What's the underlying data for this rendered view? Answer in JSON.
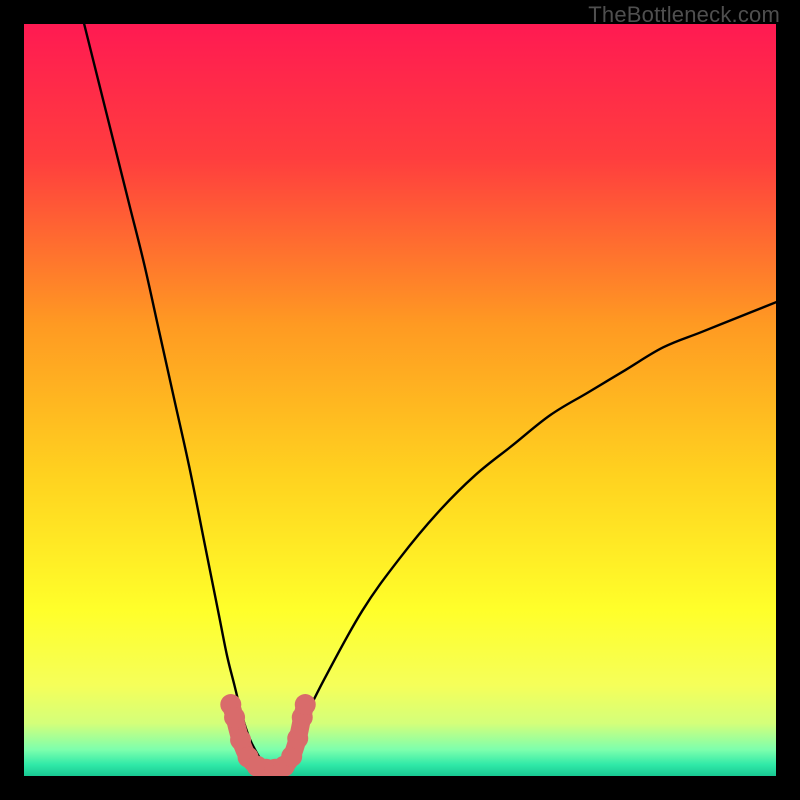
{
  "watermark": "TheBottleneck.com",
  "chart_data": {
    "type": "line",
    "title": "",
    "xlabel": "",
    "ylabel": "",
    "xlim": [
      0,
      100
    ],
    "ylim": [
      0,
      100
    ],
    "gradient_stops": [
      {
        "pos": 0.0,
        "color": "#ff1a52"
      },
      {
        "pos": 0.18,
        "color": "#ff3e3e"
      },
      {
        "pos": 0.4,
        "color": "#ff9a22"
      },
      {
        "pos": 0.6,
        "color": "#ffd21f"
      },
      {
        "pos": 0.78,
        "color": "#ffff2a"
      },
      {
        "pos": 0.88,
        "color": "#f5ff5a"
      },
      {
        "pos": 0.93,
        "color": "#d4ff7a"
      },
      {
        "pos": 0.965,
        "color": "#7dffad"
      },
      {
        "pos": 0.985,
        "color": "#30e9a8"
      },
      {
        "pos": 1.0,
        "color": "#18c792"
      }
    ],
    "series": [
      {
        "name": "left-curve",
        "x": [
          8,
          10,
          12,
          14,
          16,
          18,
          20,
          22,
          24,
          25,
          26,
          27,
          28,
          29,
          30,
          31,
          32,
          33
        ],
        "y": [
          100,
          92,
          84,
          76,
          68,
          59,
          50,
          41,
          31,
          26,
          21,
          16,
          12,
          8,
          5,
          3,
          1.5,
          0.8
        ]
      },
      {
        "name": "right-curve",
        "x": [
          33,
          34,
          35,
          37,
          40,
          45,
          50,
          55,
          60,
          65,
          70,
          75,
          80,
          85,
          90,
          95,
          100
        ],
        "y": [
          0.8,
          1.5,
          3,
          7,
          13,
          22,
          29,
          35,
          40,
          44,
          48,
          51,
          54,
          57,
          59,
          61,
          63
        ]
      }
    ],
    "marker_segment": {
      "name": "bottom-markers",
      "color": "#d96b6b",
      "points": [
        {
          "x": 27.5,
          "y": 9.5
        },
        {
          "x": 28.0,
          "y": 7.8
        },
        {
          "x": 28.8,
          "y": 4.8
        },
        {
          "x": 29.8,
          "y": 2.5
        },
        {
          "x": 31.0,
          "y": 1.3
        },
        {
          "x": 32.2,
          "y": 0.9
        },
        {
          "x": 33.4,
          "y": 0.9
        },
        {
          "x": 34.6,
          "y": 1.3
        },
        {
          "x": 35.6,
          "y": 2.6
        },
        {
          "x": 36.4,
          "y": 5.0
        },
        {
          "x": 37.0,
          "y": 7.8
        },
        {
          "x": 37.4,
          "y": 9.5
        }
      ]
    }
  }
}
